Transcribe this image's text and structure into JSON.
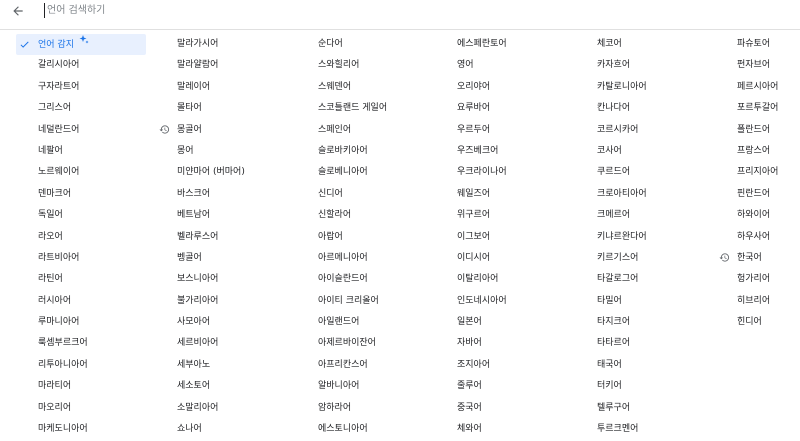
{
  "search": {
    "placeholder": "언어 검색하기"
  },
  "columns": [
    [
      "언어 감지",
      "갈리시아어",
      "구자라트어",
      "그리스어",
      "네덜란드어",
      "네팔어",
      "노르웨이어",
      "덴마크어",
      "독일어",
      "라오어",
      "라트비아어",
      "라틴어",
      "러시아어",
      "루마니아어",
      "룩셈부르크어",
      "리투아니아어",
      "마라티어",
      "마오리어",
      "마케도니아어"
    ],
    [
      "말라가시어",
      "말라얄람어",
      "말레이어",
      "몰타어",
      "몽골어",
      "몽어",
      "미얀마어 (버마어)",
      "바스크어",
      "베트남어",
      "벨라루스어",
      "벵골어",
      "보스니아어",
      "불가리아어",
      "사모아어",
      "세르비아어",
      "세부아노",
      "세소토어",
      "소말리아어",
      "쇼나어"
    ],
    [
      "순다어",
      "스와힐리어",
      "스웨덴어",
      "스코틀랜드 게일어",
      "스페인어",
      "슬로바키아어",
      "슬로베니아어",
      "신디어",
      "신할라어",
      "아랍어",
      "아르메니아어",
      "아이슬란드어",
      "아이티 크리올어",
      "아일랜드어",
      "아제르바이잔어",
      "아프리칸스어",
      "알바니아어",
      "암하라어",
      "에스토니아어"
    ],
    [
      "에스페란토어",
      "영어",
      "오리야어",
      "요루바어",
      "우르두어",
      "우즈베크어",
      "우크라이나어",
      "웨일즈어",
      "위구르어",
      "이그보어",
      "이디시어",
      "이탈리아어",
      "인도네시아어",
      "일본어",
      "자바어",
      "조지아어",
      "줄루어",
      "중국어",
      "체와어"
    ],
    [
      "체코어",
      "카자흐어",
      "카탈로니아어",
      "칸나다어",
      "코르시카어",
      "코사어",
      "쿠르드어",
      "크로아티아어",
      "크메르어",
      "키냐르완다어",
      "키르기스어",
      "타갈로그어",
      "타밀어",
      "타지크어",
      "타타르어",
      "태국어",
      "터키어",
      "텔루구어",
      "투르크멘어"
    ],
    [
      "파슈토어",
      "펀자브어",
      "페르시아어",
      "포르투갈어",
      "폴란드어",
      "프랑스어",
      "프리지아어",
      "핀란드어",
      "하와이어",
      "하우사어",
      "한국어",
      "헝가리어",
      "히브리어",
      "힌디어"
    ]
  ]
}
